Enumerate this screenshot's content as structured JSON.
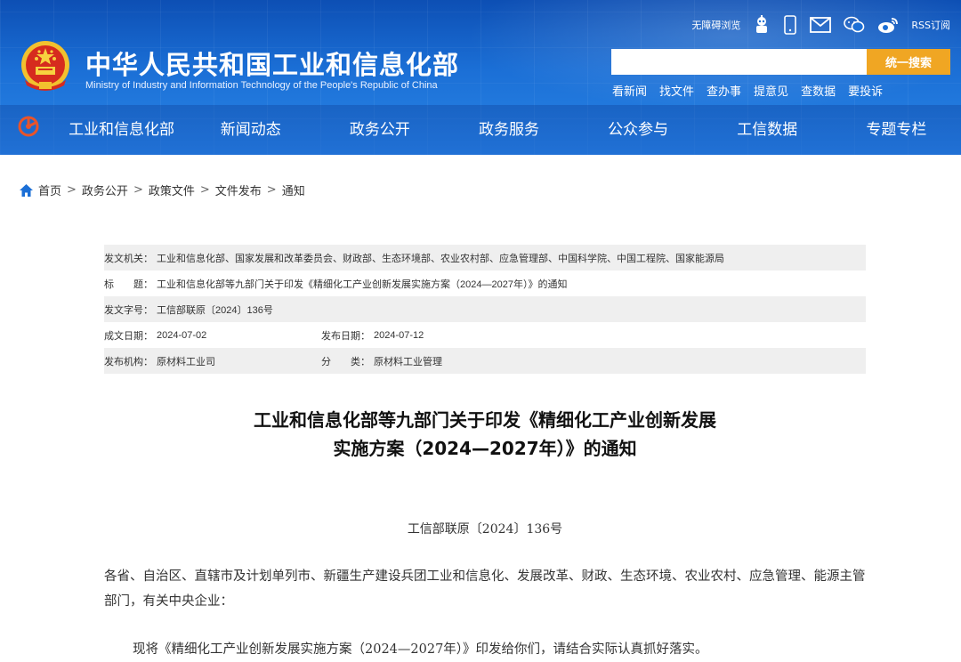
{
  "header": {
    "site_title": "中华人民共和国工业和信息化部",
    "site_subtitle": "Ministry of Industry and Information Technology of the People's Republic of China",
    "toolbar": {
      "accessibility_label": "无障碍浏览",
      "rss_label": "RSS订阅"
    },
    "search": {
      "placeholder": "",
      "button_label": "统一搜索"
    },
    "quick_links": [
      "看新闻",
      "找文件",
      "查办事",
      "提意见",
      "查数据",
      "要投诉"
    ],
    "nav": [
      "工业和信息化部",
      "新闻动态",
      "政务公开",
      "政务服务",
      "公众参与",
      "工信数据",
      "专题专栏"
    ]
  },
  "breadcrumb": [
    "首页",
    "政务公开",
    "政策文件",
    "文件发布",
    "通知"
  ],
  "meta": {
    "issuer_label": "发文机关：",
    "issuer_value": "工业和信息化部、国家发展和改革委员会、财政部、生态环境部、农业农村部、应急管理部、中国科学院、中国工程院、国家能源局",
    "title_label": "标　　题：",
    "title_value": "工业和信息化部等九部门关于印发《精细化工产业创新发展实施方案（2024—2027年）》的通知",
    "docno_label": "发文字号：",
    "docno_value": "工信部联原〔2024〕136号",
    "written_label": "成文日期：",
    "written_value": "2024-07-02",
    "published_label": "发布日期：",
    "published_value": "2024-07-12",
    "agency_label": "发布机构：",
    "agency_value": "原材料工业司",
    "category_label": "分　　类：",
    "category_value": "原材料工业管理"
  },
  "document": {
    "title_line1": "工业和信息化部等九部门关于印发《精细化工产业创新发展",
    "title_line2": "实施方案（2024—2027年）》的通知",
    "doc_number": "工信部联原〔2024〕136号",
    "para1": "各省、自治区、直辖市及计划单列市、新疆生产建设兵团工业和信息化、发展改革、财政、生态环境、农业农村、应急管理、能源主管部门，有关中央企业：",
    "para2": "现将《精细化工产业创新发展实施方案（2024—2027年）》印发给你们，请结合实际认真抓好落实。"
  },
  "colors": {
    "header_blue": "#1b6fd6",
    "search_button": "#f0a623",
    "meta_shade": "#efefef"
  }
}
